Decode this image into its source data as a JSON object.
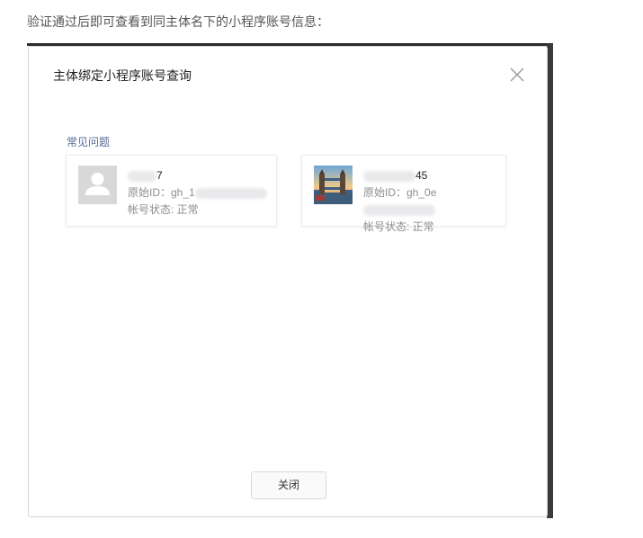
{
  "intro_text": "验证通过后即可查看到同主体名下的小程序账号信息：",
  "dialog": {
    "title": "主体绑定小程序账号查询",
    "faq_label": "常见问题",
    "close_button_label": "关闭"
  },
  "accounts": [
    {
      "name_suffix": "7",
      "original_id_prefix": "原始ID：gh_1",
      "status": "帐号状态: 正常",
      "avatar": "default-user-icon"
    },
    {
      "name_suffix": "45",
      "original_id_prefix": "原始ID：gh_0e",
      "status": "帐号状态: 正常",
      "avatar": "tower-bridge-photo"
    }
  ],
  "colors": {
    "link": "#576b95",
    "avatar_placeholder": "#d8d8d8"
  }
}
